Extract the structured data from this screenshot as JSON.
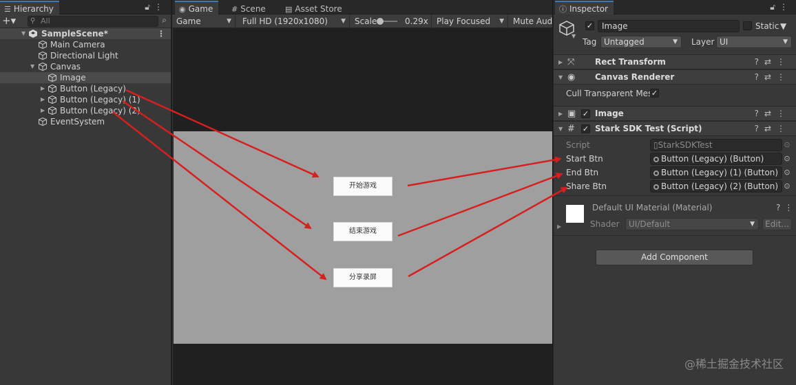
{
  "hierarchy": {
    "tab": "Hierarchy",
    "search_placeholder": "All",
    "scene": "SampleScene*",
    "items": [
      "Main Camera",
      "Directional Light",
      "Canvas",
      "Image",
      "Button (Legacy)",
      "Button (Legacy) (1)",
      "Button (Legacy) (2)",
      "EventSystem"
    ]
  },
  "game": {
    "tabs": [
      "Game",
      "Scene",
      "Asset Store"
    ],
    "display": "Game",
    "resolution": "Full HD (1920x1080)",
    "scale_label": "Scale",
    "scale_value": "0.29x",
    "play_mode": "Play Focused",
    "mute": "Mute Audio",
    "buttons": [
      "开始游戏",
      "结束游戏",
      "分享录屏"
    ]
  },
  "inspector": {
    "tab": "Inspector",
    "object_name": "Image",
    "static_label": "Static",
    "tag_label": "Tag",
    "tag_value": "Untagged",
    "layer_label": "Layer",
    "layer_value": "UI",
    "components": {
      "rect_transform": "Rect Transform",
      "canvas_renderer": "Canvas Renderer",
      "cull_label": "Cull Transparent Mes",
      "image": "Image",
      "script": "Stark SDK Test (Script)"
    },
    "script_fields": {
      "script_label": "Script",
      "script_value": "StarkSDKTest",
      "start_label": "Start Btn",
      "start_value": "Button (Legacy) (Button)",
      "end_label": "End Btn",
      "end_value": "Button (Legacy) (1) (Button)",
      "share_label": "Share Btn",
      "share_value": "Button (Legacy) (2) (Button)"
    },
    "material": {
      "name": "Default UI Material (Material)",
      "shader_label": "Shader",
      "shader_value": "UI/Default",
      "edit": "Edit..."
    },
    "add_component": "Add Component"
  },
  "watermark": "@稀土掘金技术社区",
  "colors": {
    "arrow": "#d61f1f",
    "tab_accent": "#3a79bb"
  }
}
